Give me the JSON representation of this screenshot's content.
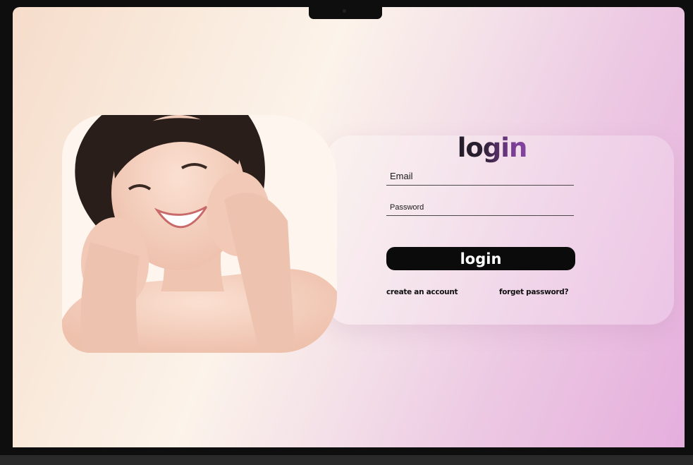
{
  "login_form": {
    "title": "login",
    "email_placeholder": "Email",
    "email_value": "",
    "password_placeholder": "Password",
    "password_value": "",
    "login_button_label": "login",
    "create_account_link": "create an account",
    "forgot_password_link": "forget password?"
  },
  "hero": {
    "image": "smiling-woman-photo"
  },
  "colors": {
    "accent_gradient_start": "#1a1a1a",
    "accent_gradient_end": "#b165d8",
    "button_bg": "#0b0b0b",
    "background_start": "#f6dccb",
    "background_end": "#e5aedd"
  }
}
